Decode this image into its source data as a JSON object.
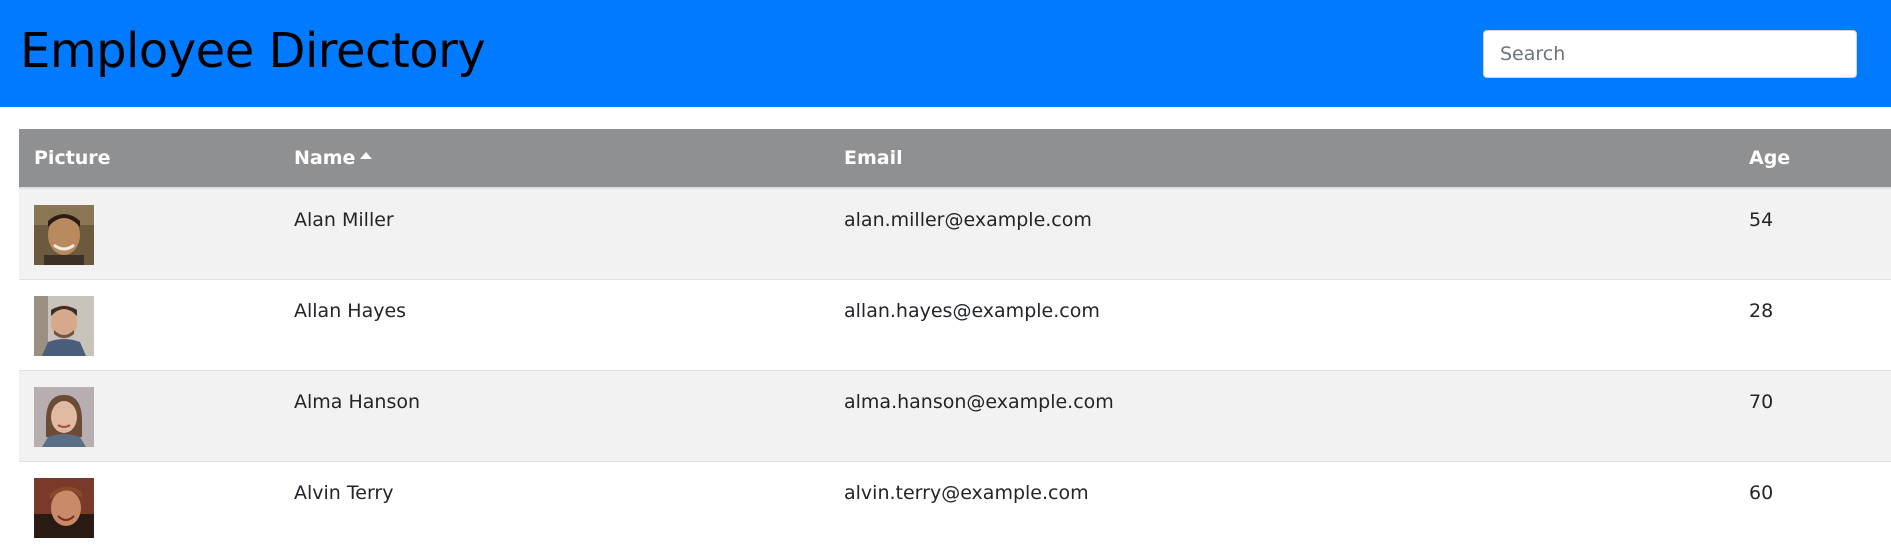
{
  "header": {
    "title": "Employee Directory",
    "background_color": "#007bff"
  },
  "search": {
    "placeholder": "Search",
    "value": ""
  },
  "table": {
    "header_color": "#8e9092",
    "columns": [
      "Picture",
      "Name",
      "Email",
      "Age"
    ],
    "sorted_column": "Name",
    "sort_direction": "ascending",
    "sort_icon": "caret-up-icon",
    "rows": [
      {
        "name": "Alan Miller",
        "email": "alan.miller@example.com",
        "age": "54"
      },
      {
        "name": "Allan Hayes",
        "email": "allan.hayes@example.com",
        "age": "28"
      },
      {
        "name": "Alma Hanson",
        "email": "alma.hanson@example.com",
        "age": "70"
      },
      {
        "name": "Alvin Terry",
        "email": "alvin.terry@example.com",
        "age": "60"
      }
    ]
  }
}
